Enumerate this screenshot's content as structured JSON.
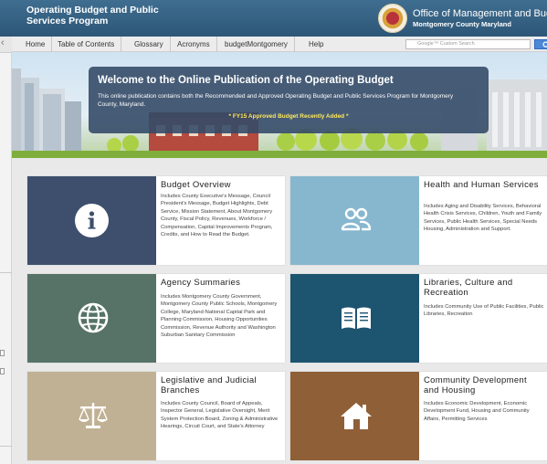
{
  "header": {
    "site_title": "Operating Budget and Public Services Program",
    "office_name": "Office of Management and Budget",
    "office_sub": "Montgomery County Maryland"
  },
  "nav": {
    "items": [
      "Home",
      "Table of Contents",
      "Glossary",
      "Acronyms",
      "budgetMontgomery",
      "Help"
    ],
    "search_placeholder": "Google™ Custom Search"
  },
  "hero": {
    "heading": "Welcome to the Online Publication of the Operating Budget",
    "paragraph": "This online publication contains both the Recommended and Approved Operating Budget and Public Services Program for Montgomery County, Maryland.",
    "notice": "* FY15 Approved Budget Recently Added *",
    "notice_color": "#ffe95a"
  },
  "cards": [
    {
      "title": "Budget Overview",
      "icon": "info-icon",
      "color": "#3d4f6d",
      "description": "Includes County Executive's Message, Council President's Message, Budget Highlights, Debt Service, Mission Statement, About Montgomery County, Fiscal Policy, Revenues, Workforce / Compensation, Capital Improvements Program, Credits, and How to Read the Budget."
    },
    {
      "title": "Health and Human Services",
      "icon": "people-icon",
      "color": "#86b7cf",
      "description": "Includes Aging and Disability Services, Behavioral Health Crisis Services, Children, Youth and Family Services, Public Health Services, Special Needs Housing, Administration and Support."
    },
    {
      "title": "Agency Summaries",
      "icon": "globe-icon",
      "color": "#577367",
      "description": "Includes Montgomery County Government, Montgomery County Public Schools, Montgomery College, Maryland-National Capital Park and Planning Commission, Housing Opportunities Commission, Revenue Authority and Washington Suburban Sanitary Commission"
    },
    {
      "title": "Libraries, Culture and Recreation",
      "icon": "book-icon",
      "color": "#1d5470",
      "description": "Includes Community Use of Public Facilities, Public Libraries, Recreation"
    },
    {
      "title": "Legislative and Judicial Branches",
      "icon": "scales-icon",
      "color": "#c1b194",
      "description": "Includes County Council, Board of Appeals, Inspector General, Legislative Oversight, Merit System Protection Board, Zoning & Administrative Hearings, Circuit Court, and State's Attorney"
    },
    {
      "title": "Community Development and Housing",
      "icon": "house-icon",
      "color": "#8f5f37",
      "description": "Includes Economic Development, Economic Development Fund, Housing and Community Affairs, Permitting Services"
    }
  ]
}
